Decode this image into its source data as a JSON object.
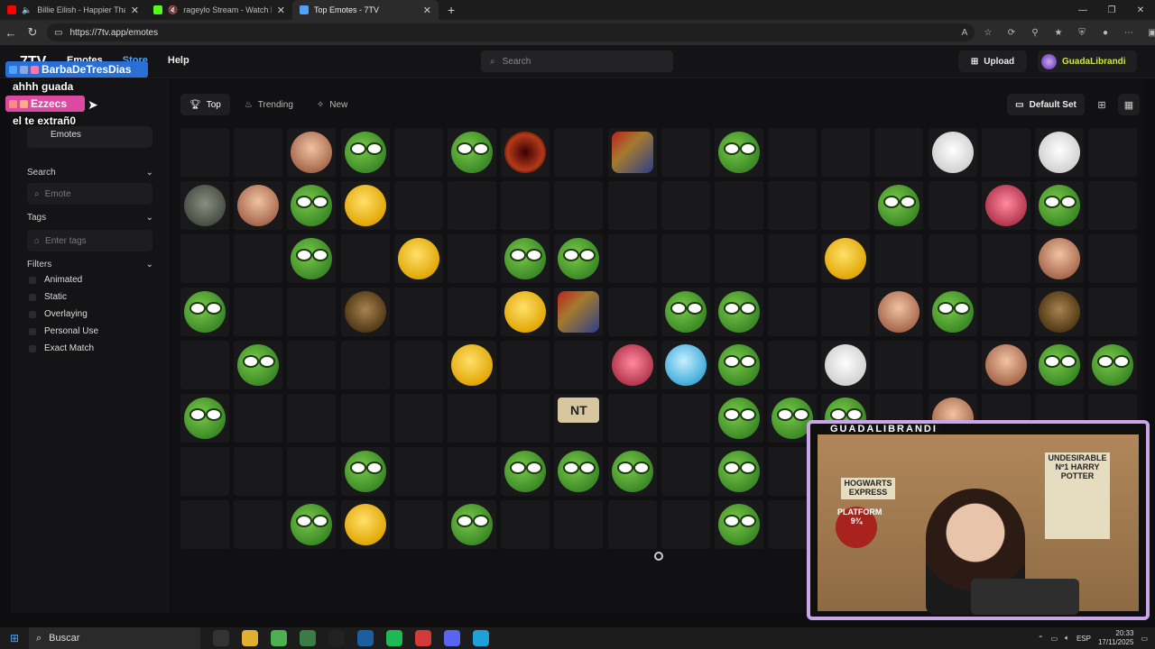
{
  "browser": {
    "tabs": [
      {
        "title": "Billie Eilish - Happier Than Ev",
        "favicon_color": "#ff0000",
        "active": false
      },
      {
        "title": "rageylo Stream - Watch Live",
        "favicon_color": "#53fc18",
        "active": false
      },
      {
        "title": "Top Emotes - 7TV",
        "favicon_color": "#4ea3ff",
        "active": true
      }
    ],
    "url": "https://7tv.app/emotes"
  },
  "header": {
    "logo": "7TV",
    "nav": {
      "emotes": "Emotes",
      "store": "Store",
      "help": "Help"
    },
    "search_placeholder": "Search",
    "upload_label": "Upload",
    "username": "GuadaLibrandi"
  },
  "sidebar": {
    "selected_tab": "Emotes",
    "search_label": "Search",
    "emote_placeholder": "Emote",
    "tags_label": "Tags",
    "tags_placeholder": "Enter tags",
    "filters_label": "Filters",
    "filters": [
      "Animated",
      "Static",
      "Overlaying",
      "Personal Use",
      "Exact Match"
    ]
  },
  "main": {
    "sort_tabs": [
      "Top",
      "Trending",
      "New"
    ],
    "default_set_label": "Default Set",
    "grid": [
      [
        "",
        "",
        "face",
        "pepe",
        "",
        "pepe",
        "dark",
        "",
        "multi",
        "",
        "pepe",
        "",
        "",
        "",
        "white",
        "",
        "white",
        ""
      ],
      [
        "grey",
        "face",
        "pepe",
        "yellow",
        "",
        "",
        "",
        "",
        "",
        "",
        "",
        "",
        "",
        "pepe",
        "",
        "pink",
        "pepe",
        ""
      ],
      [
        "",
        "",
        "pepe",
        "",
        "yellow",
        "",
        "pepe",
        "pepe",
        "",
        "",
        "",
        "",
        "yellow",
        "",
        "",
        "",
        "face",
        ""
      ],
      [
        "pepe",
        "",
        "",
        "brown",
        "",
        "",
        "yellow",
        "multi",
        "",
        "pepe",
        "pepe",
        "",
        "",
        "face",
        "pepe",
        "",
        "brown",
        ""
      ],
      [
        "",
        "pepe",
        "",
        "",
        "",
        "yellow",
        "",
        "",
        "pink",
        "blue",
        "pepe",
        "",
        "white",
        "",
        "",
        "face",
        "pepe",
        "pepe"
      ],
      [
        "pepe",
        "",
        "",
        "",
        "",
        "",
        "",
        "nt",
        "",
        "",
        "pepe",
        "pepe",
        "pepe",
        "",
        "face",
        "",
        "",
        ""
      ],
      [
        "",
        "",
        "",
        "pepe",
        "",
        "",
        "pepe",
        "pepe",
        "pepe",
        "",
        "pepe",
        "",
        "",
        "",
        "",
        "",
        "",
        ""
      ],
      [
        "",
        "",
        "pepe",
        "yellow",
        "",
        "pepe",
        "",
        "",
        "",
        "",
        "pepe",
        "",
        "",
        "",
        "",
        "",
        "",
        ""
      ]
    ],
    "nt_text": "NT"
  },
  "overlay": {
    "chat": [
      {
        "name": "BarbaDeTresDias",
        "color": "#2a6fd6",
        "message": "ahhh guada"
      },
      {
        "name": "Ezzecs",
        "color": "#d94aa0",
        "message": "el te extrañ0"
      }
    ],
    "stream_name": "GUADALIBRANDI",
    "posters": {
      "platform": "PLATFORM 9¾",
      "wanted": "UNDESIRABLE Nº1 HARRY POTTER",
      "express": "HOGWARTS EXPRESS"
    }
  },
  "taskbar": {
    "search_label": "Buscar",
    "language": "ESP",
    "time": "20:33",
    "date": "17/11/2025"
  }
}
